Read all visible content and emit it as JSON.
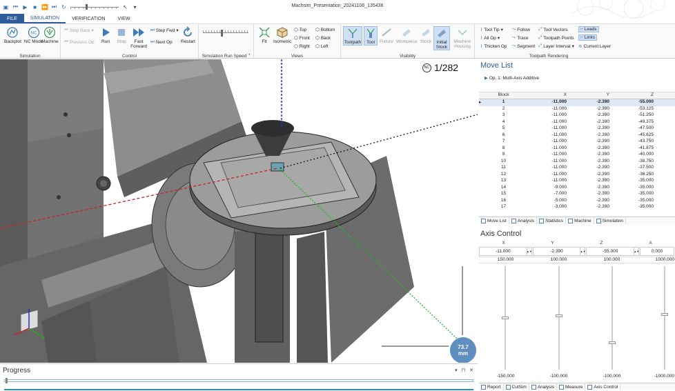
{
  "window": {
    "title": "Machsim_Presentation_20241106_135436"
  },
  "tabs": [
    {
      "label": "FILE"
    },
    {
      "label": "SIMULATION"
    },
    {
      "label": "VERIFICATION"
    },
    {
      "label": "VIEW"
    }
  ],
  "ribbon": {
    "simulation": {
      "label": "Simulation",
      "backplot": "Backplot",
      "nc_mode": "NC Mode",
      "machine": "Machine"
    },
    "control": {
      "label": "Control",
      "step_back": "Step Back",
      "previous_op": "Previous Op",
      "run": "Run",
      "stop": "Stop",
      "fast_forward": "Fast Forward",
      "step_fwd": "Step Fwd",
      "next_op": "Next Op",
      "restart": "Restart"
    },
    "speed": {
      "label": "Simulation Run Speed"
    },
    "views": {
      "label": "Views",
      "fit": "Fit",
      "isometric": "Isometric",
      "top": "Top",
      "bottom": "Bottom",
      "front": "Front",
      "back": "Back",
      "right": "Right",
      "left": "Left"
    },
    "visibility": {
      "label": "Visibility",
      "toolpath": "Toolpath",
      "tool": "Tool",
      "fixture": "Fixture",
      "workpiece": "Workpiece",
      "stock": "Stock",
      "initial_stock": "Initial Stock",
      "machine_housing": "Machine Housing"
    },
    "rendering": {
      "label": "Toolpath Rendering",
      "tool_tip": "Tool Tip",
      "follow": "Follow",
      "tool_vectors": "Tool Vectors",
      "leads": "Leads",
      "all_op": "All Op",
      "trace": "Trace",
      "toolpath_points": "Toolpath Points",
      "links": "Links",
      "thicken_op": "Thicken Op",
      "segment": "Segment",
      "layer_interval": "Layer Interval",
      "current_layer": "Current Layer"
    }
  },
  "viewport": {
    "counter": "1/282",
    "nc_badge": "NC",
    "scale_value": "73.7",
    "scale_unit": "mm"
  },
  "move_list": {
    "title": "Move List",
    "operation": "Op. 1: Multi-Axis Additive",
    "headers": [
      "Block",
      "X",
      "Y",
      "Z"
    ],
    "rows": [
      [
        "1",
        "-11.000",
        "-2.390",
        "-55.000"
      ],
      [
        "2",
        "-11.000",
        "-2.390",
        "-53.125"
      ],
      [
        "3",
        "-11.000",
        "-2.390",
        "-51.250"
      ],
      [
        "4",
        "-11.000",
        "-2.390",
        "-49.375"
      ],
      [
        "5",
        "-11.000",
        "-2.390",
        "-47.500"
      ],
      [
        "6",
        "-11.000",
        "-2.390",
        "-45.625"
      ],
      [
        "7",
        "-11.000",
        "-2.390",
        "-43.750"
      ],
      [
        "8",
        "-11.000",
        "-2.390",
        "-41.875"
      ],
      [
        "9",
        "-11.000",
        "-2.390",
        "-40.000"
      ],
      [
        "10",
        "-11.000",
        "-2.390",
        "-38.750"
      ],
      [
        "11",
        "-11.000",
        "-2.390",
        "-37.500"
      ],
      [
        "12",
        "-11.000",
        "-2.390",
        "-36.250"
      ],
      [
        "13",
        "-11.000",
        "-2.390",
        "-35.000"
      ],
      [
        "14",
        "-9.000",
        "-2.390",
        "-35.000"
      ],
      [
        "15",
        "-7.000",
        "-2.390",
        "-35.000"
      ],
      [
        "16",
        "-5.000",
        "-2.390",
        "-35.000"
      ],
      [
        "17",
        "-3.000",
        "-2.390",
        "-35.000"
      ]
    ],
    "tabs": [
      "Move List",
      "Analysis",
      "Statistics",
      "Machine",
      "Simulation"
    ]
  },
  "axis_control": {
    "title": "Axis Control",
    "axes": [
      "X",
      "Y",
      "Z",
      "A"
    ],
    "values": [
      "-11.000",
      "-2.390",
      "-55.000",
      "0.000"
    ],
    "max": [
      "150.000",
      "100.000",
      "100.000",
      "1000.000"
    ],
    "min": [
      "-150.000",
      "-100.000",
      "-100.000",
      "-1000.000"
    ],
    "tabs": [
      "Report",
      "CutSim",
      "Analysis",
      "Measure",
      "Axis Control"
    ]
  },
  "progress": {
    "title": "Progress"
  }
}
